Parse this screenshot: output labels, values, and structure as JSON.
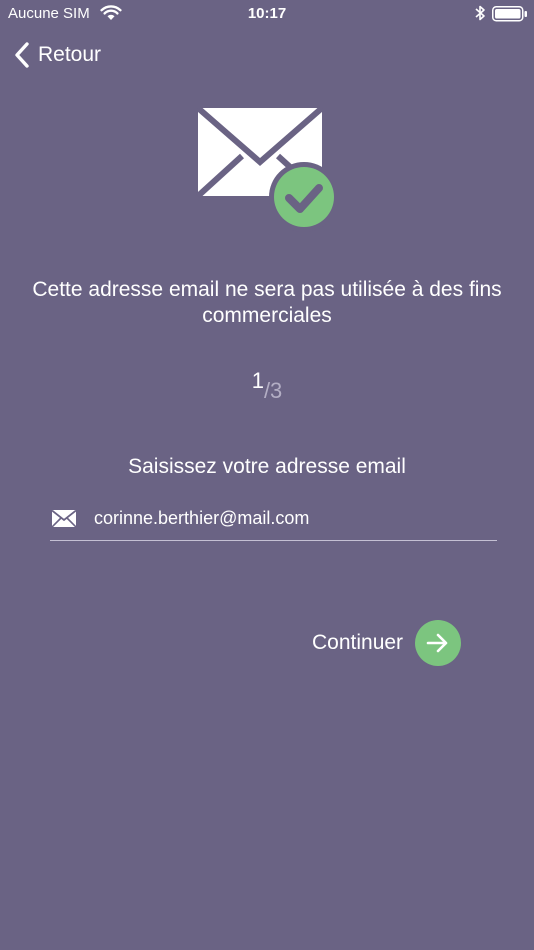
{
  "status_bar": {
    "carrier": "Aucune SIM",
    "time": "10:17"
  },
  "nav": {
    "back_label": "Retour"
  },
  "content": {
    "info_text": "Cette adresse email ne sera pas utilisée à des fins commerciales",
    "step_current": "1",
    "step_total": "/3",
    "prompt": "Saisissez votre adresse email",
    "email_value": "corinne.berthier@mail.com",
    "continue_label": "Continuer"
  },
  "colors": {
    "background": "#6a6384",
    "accent_green": "#7cc57f",
    "text": "#ffffff"
  },
  "icons": {
    "hero": "mail-check-icon",
    "field": "envelope-icon",
    "continue": "arrow-right-icon",
    "back": "chevron-left-icon"
  }
}
